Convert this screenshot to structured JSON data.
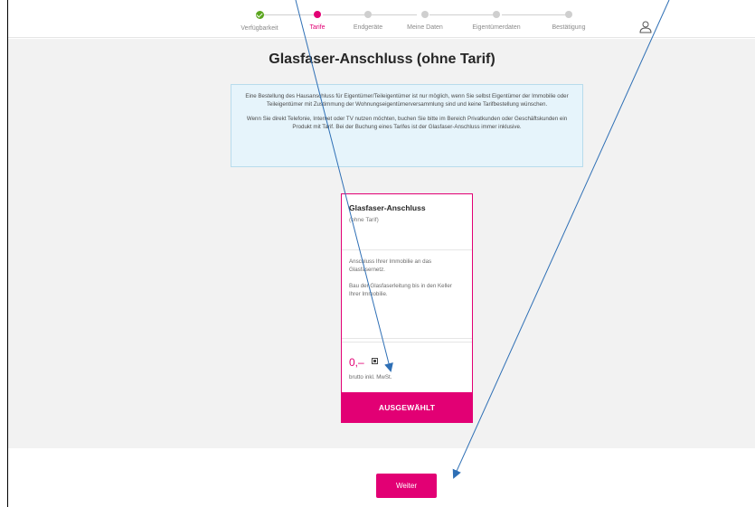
{
  "progress": {
    "steps": [
      {
        "label": "Verfügbarkeit",
        "state": "done"
      },
      {
        "label": "Tarife",
        "state": "active"
      },
      {
        "label": "Endgeräte",
        "state": "todo"
      },
      {
        "label": "Meine Daten",
        "state": "todo"
      },
      {
        "label": "Eigentümerdaten",
        "state": "todo"
      },
      {
        "label": "Bestätigung",
        "state": "todo"
      }
    ]
  },
  "header": {
    "user_icon": "user-icon"
  },
  "page": {
    "title": "Glasfaser-Anschluss (ohne Tarif)"
  },
  "info": {
    "paragraph_1": "Eine Bestellung des Hausanschluss für Eigentümer/Teileigentümer ist nur möglich, wenn Sie selbst Eigentümer der Immobilie oder Teileigentümer mit Zustimmung der Wohnungseigentümerversammlung sind und keine Tarifbestellung wünschen.",
    "paragraph_2": "Wenn Sie direkt Telefonie, Internet oder TV nutzen möchten, buchen Sie bitte im Bereich Privatkunden oder Geschäftskunden ein Produkt mit Tarif. Bei der Buchung eines Tarifes ist der Glasfaser-Anschluss immer inklusive."
  },
  "product_card": {
    "title": "Glasfaser-Anschluss",
    "subtitle": "(ohne Tarif)",
    "feature_1": "Anschluss Ihrer Immobilie an das Glasfasernetz.",
    "feature_2": "Bau der Glasfaserleitung bis in den Keller Ihrer Immobilie.",
    "price": "0,–",
    "price_note": "brutto inkl. MwSt.",
    "select_label": "AUSGEWÄHLT"
  },
  "footer": {
    "next_label": "Weiter"
  },
  "colors": {
    "brand": "#e20074",
    "done": "#5ba61f",
    "info_bg": "#e6f4fb",
    "annotation_arrow": "#2e6fb5"
  }
}
